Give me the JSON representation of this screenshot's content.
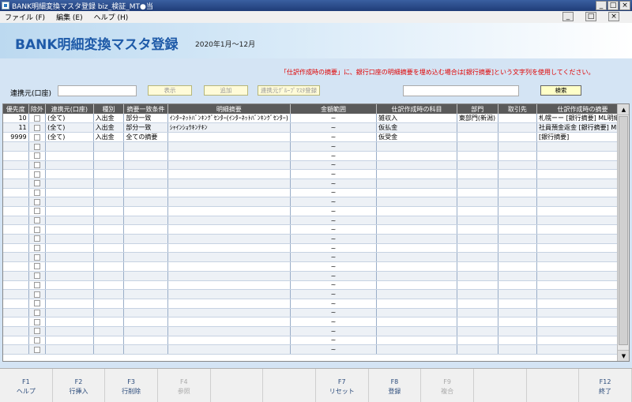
{
  "window": {
    "title": "BANK明細変換マスタ登録  biz_検証_MT●当",
    "controls": [
      "_",
      "□",
      "×"
    ]
  },
  "menu": {
    "items": [
      "ファイル (F)",
      "編集 (E)",
      "ヘルプ (H)"
    ],
    "child_controls": [
      "_",
      "□",
      "×"
    ]
  },
  "header": {
    "title": "BANK明細変換マスタ登録",
    "period": "2020年1月～12月"
  },
  "filter": {
    "notice": "「仕訳作成時の摘要」に、銀行口座の明細摘要を埋め込む場合は[銀行摘要]という文字列を使用してください。",
    "account_label": "連携元(口座)",
    "account_value": "",
    "search_value": "",
    "buttons": {
      "display": "表示",
      "add": "追加",
      "group_master": "連携元ｸﾞﾙｰﾌﾟﾏｽﾀ登録",
      "search": "検索"
    }
  },
  "grid": {
    "columns": [
      "優先度",
      "除外",
      "連携元(口座)",
      "種別",
      "摘要一致条件",
      "明細摘要",
      "金額範囲",
      "仕訳作成時の科目",
      "部門",
      "取引先",
      "仕訳作成時の摘要"
    ],
    "rows": [
      {
        "priority": "10",
        "account": "(全て)",
        "type": "入出金",
        "match": "部分一致",
        "desc": "ｲﾝﾀｰﾈｯﾄﾊﾞﾝｷﾝｸﾞｾﾝﾀｰ(ｲﾝﾀｰﾈｯﾄﾊﾞﾝｷﾝｸﾞｾﾝﾀｰ)",
        "amount": "~",
        "subject": "雑収入",
        "dept": "東部門(新潟)",
        "partner": "",
        "memo": "札幌ーー [銀行摘要] ML明細"
      },
      {
        "priority": "11",
        "account": "(全て)",
        "type": "入出金",
        "match": "部分一致",
        "desc": "ｼｬｲﾝｼｮｳｷﾝﾃｷﾝ",
        "amount": "~",
        "subject": "仮払金",
        "dept": "",
        "partner": "",
        "memo": "社員預金返金 [銀行摘要] ML明"
      },
      {
        "priority": "9999",
        "account": "(全て)",
        "type": "入出金",
        "match": "全ての摘要",
        "desc": "",
        "amount": "~",
        "subject": "仮受金",
        "dept": "",
        "partner": "",
        "memo": "[銀行摘要]"
      }
    ],
    "empty_tilde": "~"
  },
  "fkeys": [
    {
      "key": "F1",
      "label": "ヘルプ",
      "enabled": true
    },
    {
      "key": "F2",
      "label": "行挿入",
      "enabled": true
    },
    {
      "key": "F3",
      "label": "行削除",
      "enabled": true
    },
    {
      "key": "F4",
      "label": "参照",
      "enabled": false
    },
    {
      "key": "",
      "label": "",
      "enabled": false
    },
    {
      "key": "",
      "label": "",
      "enabled": false
    },
    {
      "key": "F7",
      "label": "リセット",
      "enabled": true
    },
    {
      "key": "F8",
      "label": "登録",
      "enabled": true
    },
    {
      "key": "F9",
      "label": "複合",
      "enabled": false
    },
    {
      "key": "",
      "label": "",
      "enabled": false
    },
    {
      "key": "",
      "label": "",
      "enabled": false
    },
    {
      "key": "F12",
      "label": "終了",
      "enabled": true
    }
  ]
}
